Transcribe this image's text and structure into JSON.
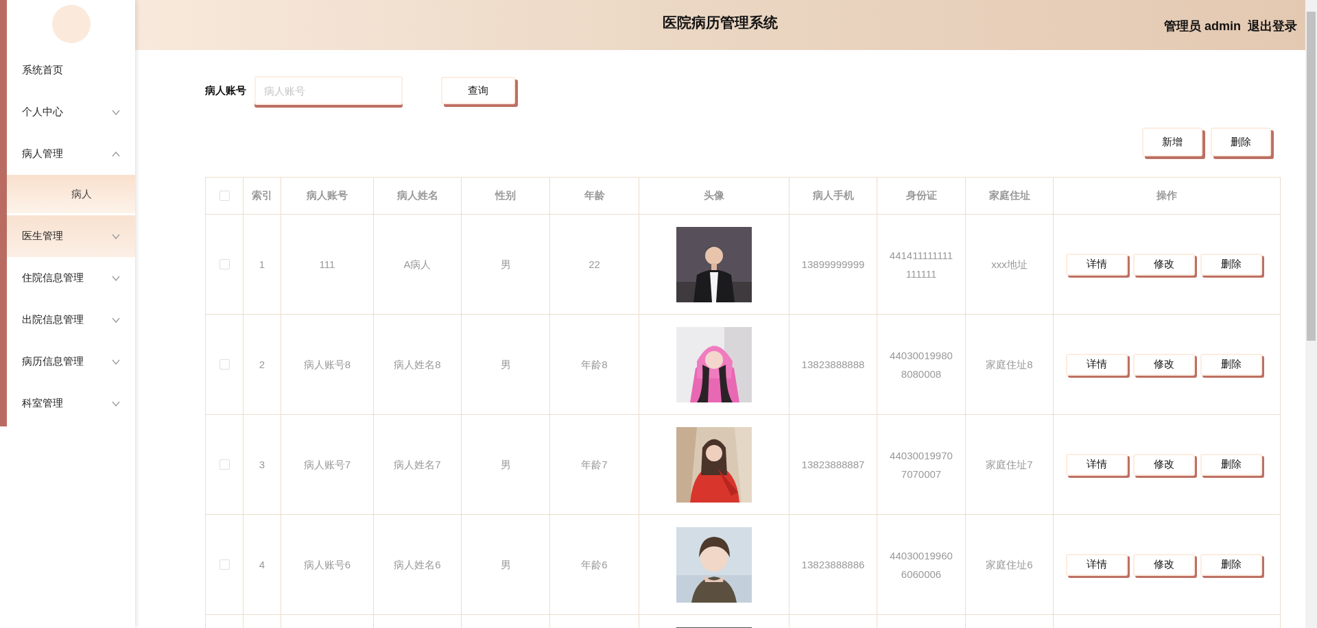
{
  "sidebar": {
    "items": [
      {
        "label": "系统首页",
        "hovered": false
      },
      {
        "label": "个人中心",
        "expanded": false,
        "hovered": false
      },
      {
        "label": "病人管理",
        "expanded": true,
        "hovered": false,
        "children": [
          {
            "label": "病人",
            "selected": true
          }
        ]
      },
      {
        "label": "医生管理",
        "expanded": false,
        "hovered": true
      },
      {
        "label": "住院信息管理",
        "expanded": false,
        "hovered": false
      },
      {
        "label": "出院信息管理",
        "expanded": false,
        "hovered": false
      },
      {
        "label": "病历信息管理",
        "expanded": false,
        "hovered": false
      },
      {
        "label": "科室管理",
        "expanded": false,
        "hovered": false
      }
    ]
  },
  "header": {
    "title": "医院病历管理系统",
    "user": "管理员 admin",
    "logout": "退出登录"
  },
  "search": {
    "label": "病人账号",
    "placeholder": "病人账号",
    "button": "查询"
  },
  "toolbar": {
    "buttons": [
      "新增",
      "删除"
    ]
  },
  "table": {
    "all_selected": false,
    "columns": [
      "索引",
      "病人账号",
      "病人姓名",
      "性别",
      "年龄",
      "头像",
      "病人手机",
      "身份证",
      "家庭住址",
      "操作"
    ],
    "rows": [
      {
        "selected": false,
        "index": "1",
        "account": "111",
        "name": "A病人",
        "gender": "男",
        "age": "22",
        "avatar": {
          "kind": "picture"
        },
        "phone": "13899999999",
        "id_card": "441411111111111111",
        "address": "xxx地址",
        "actions": [
          "详情",
          "修改",
          "删除"
        ]
      },
      {
        "selected": false,
        "index": "2",
        "account": "病人账号8",
        "name": "病人姓名8",
        "gender": "男",
        "age": "年龄8",
        "avatar": {
          "kind": "picture"
        },
        "phone": "13823888888",
        "id_card": "440300199808080008",
        "address": "家庭住址8",
        "actions": [
          "详情",
          "修改",
          "删除"
        ]
      },
      {
        "selected": false,
        "index": "3",
        "account": "病人账号7",
        "name": "病人姓名7",
        "gender": "男",
        "age": "年龄7",
        "avatar": {
          "kind": "picture"
        },
        "phone": "13823888887",
        "id_card": "440300199707070007",
        "address": "家庭住址7",
        "actions": [
          "详情",
          "修改",
          "删除"
        ]
      },
      {
        "selected": false,
        "index": "4",
        "account": "病人账号6",
        "name": "病人姓名6",
        "gender": "男",
        "age": "年龄6",
        "avatar": {
          "kind": "picture"
        },
        "phone": "13823888886",
        "id_card": "440300199606060006",
        "address": "家庭住址6",
        "actions": [
          "详情",
          "修改",
          "删除"
        ]
      },
      {
        "avatar": {
          "kind": "picture"
        }
      }
    ]
  }
}
